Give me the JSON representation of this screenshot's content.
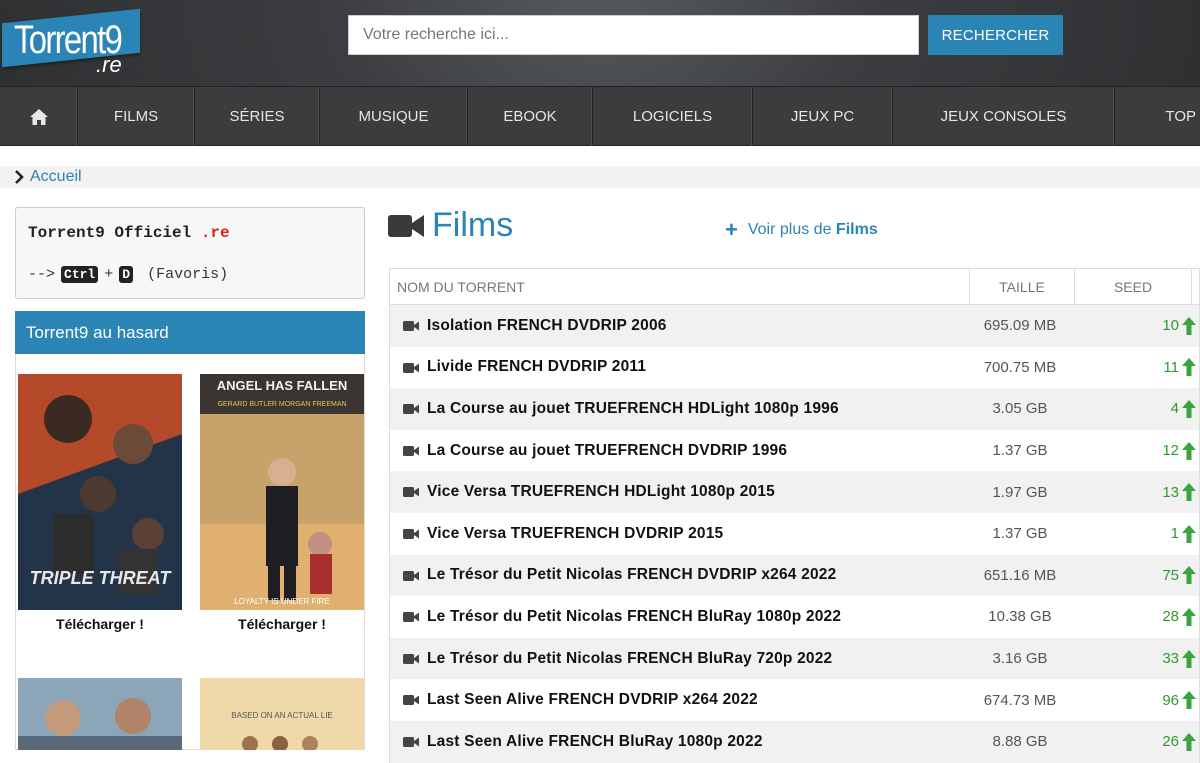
{
  "header": {
    "logo_main": "Torrent9",
    "logo_sub": ".re",
    "search_placeholder": "Votre recherche ici...",
    "search_button": "RECHERCHER"
  },
  "nav": {
    "home_icon": "home-icon",
    "items": [
      "FILMS",
      "SÉRIES",
      "MUSIQUE",
      "EBOOK",
      "LOGICIELS",
      "JEUX PC",
      "JEUX CONSOLES",
      "TOP"
    ]
  },
  "breadcrumb": {
    "label": "Accueil"
  },
  "sidebar": {
    "official_title": "Torrent9 Officiel",
    "official_tld": ".re",
    "shortcut_prefix": "-->",
    "shortcut_key1": "Ctrl",
    "shortcut_plus": "+",
    "shortcut_key2": "D",
    "shortcut_suffix": "(Favoris)",
    "random_title": "Torrent9 au hasard",
    "posters": [
      {
        "caption": "Télécharger !",
        "poster_text": "TRIPLE THREAT"
      },
      {
        "caption": "Télécharger !",
        "poster_text": "ANGEL HAS FALLEN",
        "poster_names": "GERARD BUTLER   MORGAN FREEMAN",
        "poster_tagline": "LOYALTY IS UNDER FIRE"
      },
      {
        "caption": "",
        "poster_text": ""
      },
      {
        "caption": "",
        "poster_text": "BASED ON AN ACTUAL LIE"
      }
    ]
  },
  "main": {
    "section_icon": "video-camera-icon",
    "section_title": "Films",
    "more_prefix": "Voir plus de",
    "more_bold": "Films",
    "columns": [
      "NOM DU TORRENT",
      "TAILLE",
      "SEED"
    ],
    "rows": [
      {
        "title": "Isolation FRENCH DVDRIP 2006",
        "size": "695.09 MB",
        "seed": "10"
      },
      {
        "title": "Livide FRENCH DVDRIP 2011",
        "size": "700.75 MB",
        "seed": "11"
      },
      {
        "title": "La Course au jouet TRUEFRENCH HDLight 1080p 1996",
        "size": "3.05 GB",
        "seed": "4"
      },
      {
        "title": "La Course au jouet TRUEFRENCH DVDRIP 1996",
        "size": "1.37 GB",
        "seed": "12"
      },
      {
        "title": "Vice Versa TRUEFRENCH HDLight 1080p 2015",
        "size": "1.97 GB",
        "seed": "13"
      },
      {
        "title": "Vice Versa TRUEFRENCH DVDRIP 2015",
        "size": "1.37 GB",
        "seed": "1"
      },
      {
        "title": "Le Trésor du Petit Nicolas FRENCH DVDRIP x264 2022",
        "size": "651.16 MB",
        "seed": "75"
      },
      {
        "title": "Le Trésor du Petit Nicolas FRENCH BluRay 1080p 2022",
        "size": "10.38 GB",
        "seed": "28"
      },
      {
        "title": "Le Trésor du Petit Nicolas FRENCH BluRay 720p 2022",
        "size": "3.16 GB",
        "seed": "33"
      },
      {
        "title": "Last Seen Alive FRENCH DVDRIP x264 2022",
        "size": "674.73 MB",
        "seed": "96"
      },
      {
        "title": "Last Seen Alive FRENCH BluRay 1080p 2022",
        "size": "8.88 GB",
        "seed": "26"
      }
    ]
  },
  "colors": {
    "accent": "#2a84b5",
    "seed_green": "#2e9a2e",
    "header_bg": "#3b3d40",
    "tld_red": "#d9261c"
  }
}
